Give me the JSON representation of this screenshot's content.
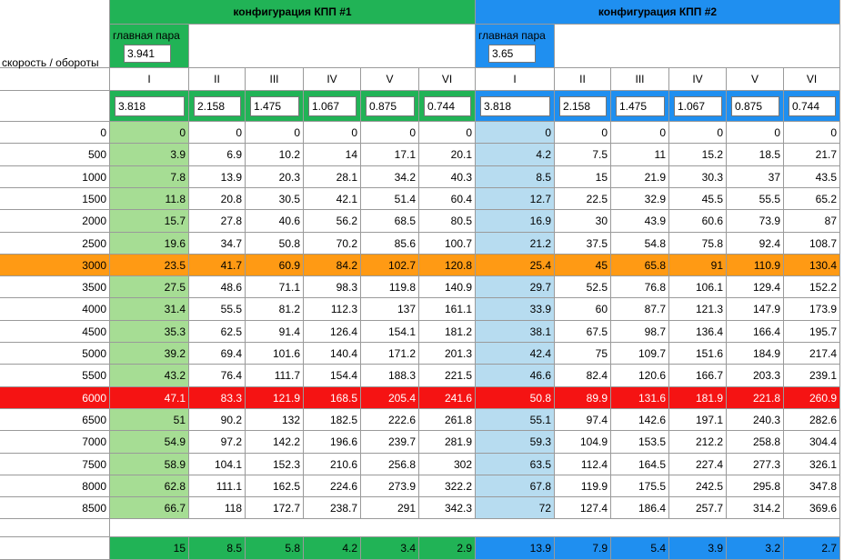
{
  "colors": {
    "green": "#21b356",
    "green_light": "#a6dd94",
    "blue": "#1f8ff0",
    "blue_light": "#b7dcf0",
    "orange": "#ff9a14",
    "red": "#f51313",
    "gridline": "#9a9a9a"
  },
  "config1": {
    "title": "конфигурация КПП #1",
    "main_pair_label": "главная пара",
    "main_pair": "3.941",
    "gears": [
      "I",
      "II",
      "III",
      "IV",
      "V",
      "VI"
    ],
    "ratios": [
      "3.818",
      "2.158",
      "1.475",
      "1.067",
      "0.875",
      "0.744"
    ]
  },
  "config2": {
    "title": "конфигурация КПП #2",
    "main_pair_label": "главная пара",
    "main_pair": "3.65",
    "gears": [
      "I",
      "II",
      "III",
      "IV",
      "V",
      "VI"
    ],
    "ratios": [
      "3.818",
      "2.158",
      "1.475",
      "1.067",
      "0.875",
      "0.744"
    ]
  },
  "row_header_label": "скорость / обороты",
  "rows": [
    {
      "rpm": "0",
      "highlight": "",
      "c1": [
        "0",
        "0",
        "0",
        "0",
        "0",
        "0"
      ],
      "c2": [
        "0",
        "0",
        "0",
        "0",
        "0",
        "0"
      ]
    },
    {
      "rpm": "500",
      "highlight": "",
      "c1": [
        "3.9",
        "6.9",
        "10.2",
        "14",
        "17.1",
        "20.1"
      ],
      "c2": [
        "4.2",
        "7.5",
        "11",
        "15.2",
        "18.5",
        "21.7"
      ]
    },
    {
      "rpm": "1000",
      "highlight": "",
      "c1": [
        "7.8",
        "13.9",
        "20.3",
        "28.1",
        "34.2",
        "40.3"
      ],
      "c2": [
        "8.5",
        "15",
        "21.9",
        "30.3",
        "37",
        "43.5"
      ]
    },
    {
      "rpm": "1500",
      "highlight": "",
      "c1": [
        "11.8",
        "20.8",
        "30.5",
        "42.1",
        "51.4",
        "60.4"
      ],
      "c2": [
        "12.7",
        "22.5",
        "32.9",
        "45.5",
        "55.5",
        "65.2"
      ]
    },
    {
      "rpm": "2000",
      "highlight": "",
      "c1": [
        "15.7",
        "27.8",
        "40.6",
        "56.2",
        "68.5",
        "80.5"
      ],
      "c2": [
        "16.9",
        "30",
        "43.9",
        "60.6",
        "73.9",
        "87"
      ]
    },
    {
      "rpm": "2500",
      "highlight": "",
      "c1": [
        "19.6",
        "34.7",
        "50.8",
        "70.2",
        "85.6",
        "100.7"
      ],
      "c2": [
        "21.2",
        "37.5",
        "54.8",
        "75.8",
        "92.4",
        "108.7"
      ]
    },
    {
      "rpm": "3000",
      "highlight": "orange",
      "c1": [
        "23.5",
        "41.7",
        "60.9",
        "84.2",
        "102.7",
        "120.8"
      ],
      "c2": [
        "25.4",
        "45",
        "65.8",
        "91",
        "110.9",
        "130.4"
      ]
    },
    {
      "rpm": "3500",
      "highlight": "",
      "c1": [
        "27.5",
        "48.6",
        "71.1",
        "98.3",
        "119.8",
        "140.9"
      ],
      "c2": [
        "29.7",
        "52.5",
        "76.8",
        "106.1",
        "129.4",
        "152.2"
      ]
    },
    {
      "rpm": "4000",
      "highlight": "",
      "c1": [
        "31.4",
        "55.5",
        "81.2",
        "112.3",
        "137",
        "161.1"
      ],
      "c2": [
        "33.9",
        "60",
        "87.7",
        "121.3",
        "147.9",
        "173.9"
      ]
    },
    {
      "rpm": "4500",
      "highlight": "",
      "c1": [
        "35.3",
        "62.5",
        "91.4",
        "126.4",
        "154.1",
        "181.2"
      ],
      "c2": [
        "38.1",
        "67.5",
        "98.7",
        "136.4",
        "166.4",
        "195.7"
      ]
    },
    {
      "rpm": "5000",
      "highlight": "",
      "c1": [
        "39.2",
        "69.4",
        "101.6",
        "140.4",
        "171.2",
        "201.3"
      ],
      "c2": [
        "42.4",
        "75",
        "109.7",
        "151.6",
        "184.9",
        "217.4"
      ]
    },
    {
      "rpm": "5500",
      "highlight": "",
      "c1": [
        "43.2",
        "76.4",
        "111.7",
        "154.4",
        "188.3",
        "221.5"
      ],
      "c2": [
        "46.6",
        "82.4",
        "120.6",
        "166.7",
        "203.3",
        "239.1"
      ]
    },
    {
      "rpm": "6000",
      "highlight": "red",
      "c1": [
        "47.1",
        "83.3",
        "121.9",
        "168.5",
        "205.4",
        "241.6"
      ],
      "c2": [
        "50.8",
        "89.9",
        "131.6",
        "181.9",
        "221.8",
        "260.9"
      ]
    },
    {
      "rpm": "6500",
      "highlight": "",
      "c1": [
        "51",
        "90.2",
        "132",
        "182.5",
        "222.6",
        "261.8"
      ],
      "c2": [
        "55.1",
        "97.4",
        "142.6",
        "197.1",
        "240.3",
        "282.6"
      ]
    },
    {
      "rpm": "7000",
      "highlight": "",
      "c1": [
        "54.9",
        "97.2",
        "142.2",
        "196.6",
        "239.7",
        "281.9"
      ],
      "c2": [
        "59.3",
        "104.9",
        "153.5",
        "212.2",
        "258.8",
        "304.4"
      ]
    },
    {
      "rpm": "7500",
      "highlight": "",
      "c1": [
        "58.9",
        "104.1",
        "152.3",
        "210.6",
        "256.8",
        "302"
      ],
      "c2": [
        "63.5",
        "112.4",
        "164.5",
        "227.4",
        "277.3",
        "326.1"
      ]
    },
    {
      "rpm": "8000",
      "highlight": "",
      "c1": [
        "62.8",
        "111.1",
        "162.5",
        "224.6",
        "273.9",
        "322.2"
      ],
      "c2": [
        "67.8",
        "119.9",
        "175.5",
        "242.5",
        "295.8",
        "347.8"
      ]
    },
    {
      "rpm": "8500",
      "highlight": "",
      "c1": [
        "66.7",
        "118",
        "172.7",
        "238.7",
        "291",
        "342.3"
      ],
      "c2": [
        "72",
        "127.4",
        "186.4",
        "257.7",
        "314.2",
        "369.6"
      ]
    }
  ],
  "bottom": {
    "c1": [
      "15",
      "8.5",
      "5.8",
      "4.2",
      "3.4",
      "2.9"
    ],
    "c2": [
      "13.9",
      "7.9",
      "5.4",
      "3.9",
      "3.2",
      "2.7"
    ]
  }
}
